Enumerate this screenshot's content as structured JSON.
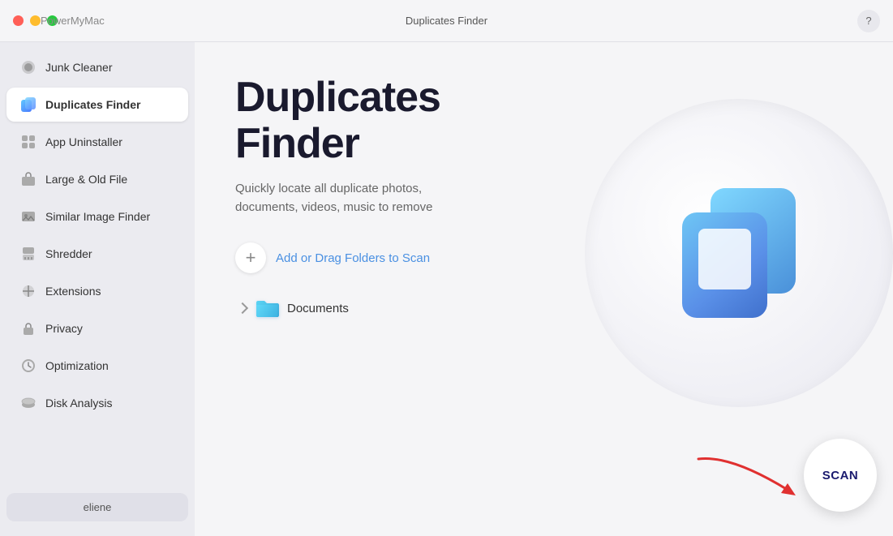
{
  "titlebar": {
    "app_name": "PowerMyMac",
    "window_title": "Duplicates Finder",
    "help_label": "?"
  },
  "sidebar": {
    "items": [
      {
        "id": "junk-cleaner",
        "label": "Junk Cleaner",
        "icon": "broom"
      },
      {
        "id": "duplicates-finder",
        "label": "Duplicates Finder",
        "icon": "duplicate",
        "active": true
      },
      {
        "id": "app-uninstaller",
        "label": "App Uninstaller",
        "icon": "apps"
      },
      {
        "id": "large-old-file",
        "label": "Large & Old File",
        "icon": "briefcase"
      },
      {
        "id": "similar-image-finder",
        "label": "Similar Image Finder",
        "icon": "image"
      },
      {
        "id": "shredder",
        "label": "Shredder",
        "icon": "shredder"
      },
      {
        "id": "extensions",
        "label": "Extensions",
        "icon": "extensions"
      },
      {
        "id": "privacy",
        "label": "Privacy",
        "icon": "lock"
      },
      {
        "id": "optimization",
        "label": "Optimization",
        "icon": "optimization"
      },
      {
        "id": "disk-analysis",
        "label": "Disk Analysis",
        "icon": "disk"
      }
    ],
    "user_label": "eliene"
  },
  "content": {
    "title_line1": "Duplicates",
    "title_line2": "Finder",
    "subtitle": "Quickly locate all duplicate photos, documents, videos, music to remove",
    "add_folder_label": "Add or Drag Folders to Scan",
    "folders": [
      {
        "name": "Documents"
      }
    ]
  },
  "scan_button": {
    "label": "SCAN"
  }
}
